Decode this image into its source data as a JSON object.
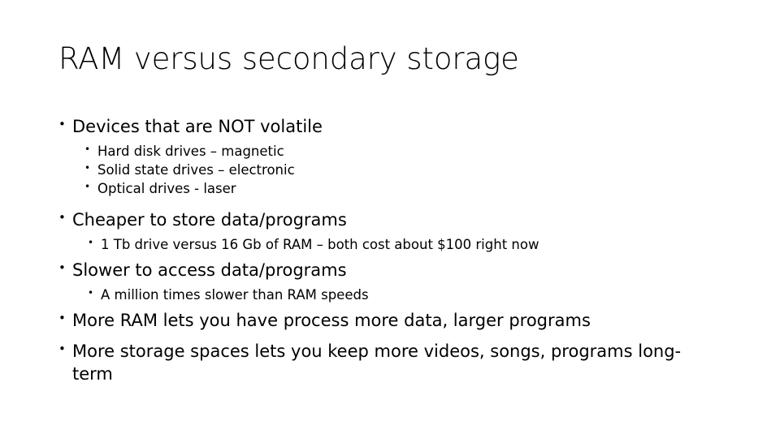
{
  "slide": {
    "title": "RAM versus secondary storage",
    "bullet_glyph": "•",
    "text_color": "#000000",
    "background_color": "#ffffff",
    "blocks": [
      {
        "level": 1,
        "text": "Devices that are NOT volatile"
      },
      {
        "level": 2,
        "text": "Hard disk drives – magnetic"
      },
      {
        "level": 2,
        "text": "Solid state drives – electronic"
      },
      {
        "level": 2,
        "text": "Optical drives - laser"
      },
      {
        "level": 1,
        "text": "Cheaper to store data/programs"
      },
      {
        "level": 2,
        "text": "1 Tb drive versus 16 Gb of RAM – both cost about $100 right now"
      },
      {
        "level": 1,
        "text": "Slower to access data/programs"
      },
      {
        "level": 2,
        "text": "A million times slower than RAM speeds"
      },
      {
        "level": 1,
        "text": "More RAM lets you have process more data, larger programs"
      },
      {
        "level": 1,
        "text_line1": "More storage spaces lets you keep more videos, songs, programs long-",
        "text_line2": "term"
      }
    ]
  }
}
